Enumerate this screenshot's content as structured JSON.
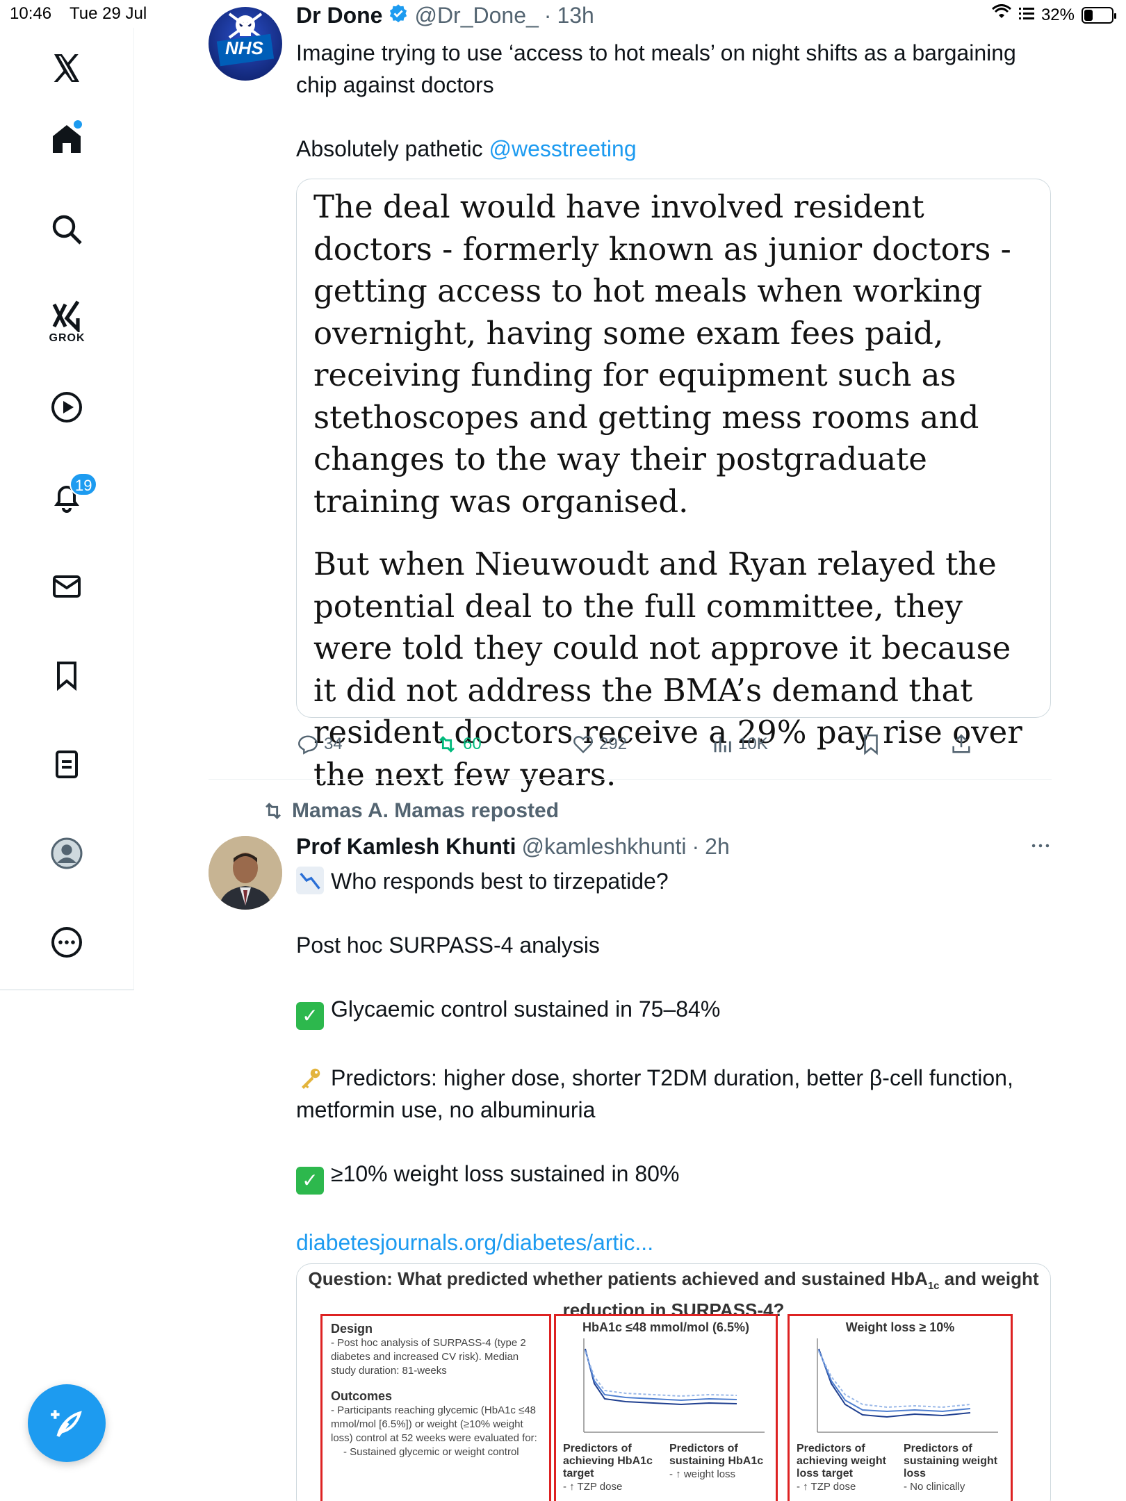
{
  "status": {
    "time": "10:46",
    "date": "Tue 29 Jul",
    "battery": "32%",
    "battery_level": 0.32
  },
  "nav": {
    "grok_label": "GROK",
    "notifications_badge": "19"
  },
  "tweet1": {
    "name": "Dr Done",
    "handle": "@Dr_Done_",
    "time": "13h",
    "avatar_text": "NHS",
    "text_line1": "Imagine trying to use ‘access to hot meals’ on night shifts as a bargaining chip against doctors",
    "text_line2_prefix": "Absolutely pathetic ",
    "mention": "@wesstreeting",
    "quote_p1": "The deal would have involved resident doctors - formerly known as junior doctors - getting access to hot meals when working overnight, having some exam fees paid, receiving funding for equipment such as stethoscopes and getting mess rooms and changes to the way their postgraduate training was organised.",
    "quote_p2": "But when Nieuwoudt and Ryan relayed the potential deal to the full committee, they were told they could not approve it because it did not address the BMA’s demand that resident doctors receive a 29% pay rise over the next few years.",
    "replies": "34",
    "reposts": "60",
    "likes": "292",
    "views": "10K"
  },
  "tweet2": {
    "reposted_by": "Mamas A. Mamas reposted",
    "name": "Prof Kamlesh Khunti",
    "handle": "@kamleshkhunti",
    "time": "2h",
    "line1": "Who responds best to tirzepatide?",
    "line2": "Post hoc SURPASS-4 analysis",
    "line3": "Glycaemic control sustained in 75–84%",
    "line4": "Predictors: higher dose, shorter T2DM duration, better β-cell function, metformin use, no albuminuria",
    "line5": "≥10% weight loss sustained in 80%",
    "link": "diabetesjournals.org/diabetes/artic...",
    "figure": {
      "title_part1": "Question: What predicted whether patients achieved and sustained  HbA",
      "title_sub": "1c",
      "title_part2": " and weight reduction in SURPASS-4?",
      "panel1_title": "Design",
      "panel1_text": "- Post hoc analysis of SURPASS-4 (type 2 diabetes and increased CV risk). Median study duration: 81-weeks",
      "panel1_outcomes": "Outcomes",
      "panel1_outcomes_text": "- Participants reaching glycemic (HbA1c ≤48 mmol/mol [6.5%]) or weight (≥10% weight loss) control at 52 weeks were evaluated for:",
      "panel1_bullet": "- Sustained glycemic or weight control",
      "panel2_title": "HbA1c ≤48 mmol/mol (6.5%)",
      "panel2_left": "Predictors of achieving HbA1c target",
      "panel2_left_b": "- ↑ TZP dose",
      "panel2_right": "Predictors of sustaining HbA1c",
      "panel2_right_b": "- ↑ weight loss",
      "panel3_title": "Weight loss ≥ 10%",
      "panel3_left": "Predictors of achieving weight loss target",
      "panel3_left_b": "- ↑ TZP dose",
      "panel3_right": "Predictors of sustaining weight loss",
      "panel3_right_b": "- No clinically"
    }
  }
}
